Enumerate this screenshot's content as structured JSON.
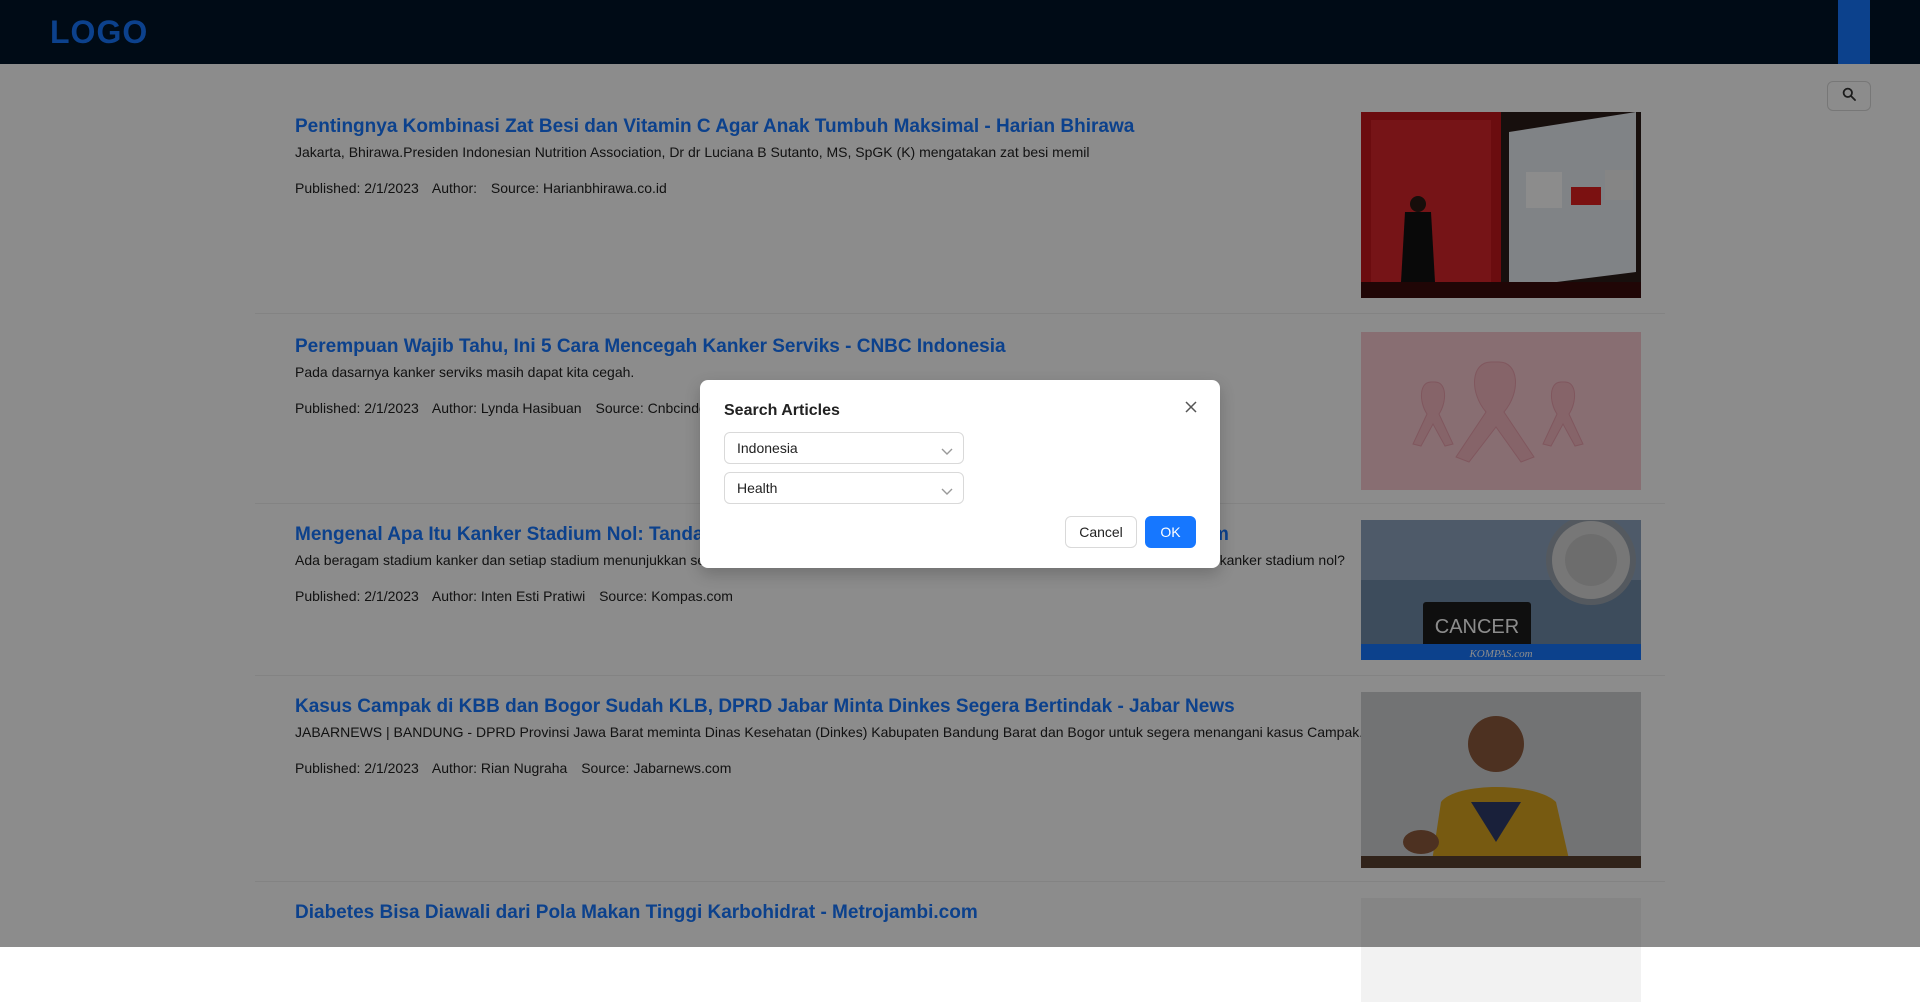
{
  "header": {
    "logo": "LOGO"
  },
  "articles": [
    {
      "title": "Pentingnya Kombinasi Zat Besi dan Vitamin C Agar Anak Tumbuh Maksimal - Harian Bhirawa",
      "description": "Jakarta, Bhirawa.Presiden Indonesian Nutrition Association, Dr dr Luciana B Sutanto, MS, SpGK (K) mengatakan zat besi memil",
      "published": "Published: 2/1/2023",
      "author": "Author:",
      "source": "Source: Harianbhirawa.co.id",
      "thumb_text": []
    },
    {
      "title": "Perempuan Wajib Tahu, Ini 5 Cara Mencegah Kanker Serviks - CNBC Indonesia",
      "description": "Pada dasarnya kanker serviks masih dapat kita cegah.",
      "published": "Published: 2/1/2023",
      "author": "Author: Lynda Hasibuan",
      "source": "Source: Cnbcindonesia.com",
      "thumb_text": []
    },
    {
      "title": "Mengenal Apa Itu Kanker Stadium Nol: Tanda-tanda, Penyebab, dan Cara Mengobatinya - KOMPAS.com",
      "description": "Ada beragam stadium kanker dan setiap stadium menunjukkan seberapa jauh kanker telah menyebar. Lalu, apa sebenarnya yang dimaksud dengan kanker stadium nol?",
      "published": "Published: 2/1/2023",
      "author": "Author: Inten Esti Pratiwi",
      "source": "Source: Kompas.com",
      "thumb_text": [
        "CANCER",
        "KOMPAS.com"
      ]
    },
    {
      "title": "Kasus Campak di KBB dan Bogor Sudah KLB, DPRD Jabar Minta Dinkes Segera Bertindak - Jabar News",
      "description": "JABARNEWS | BANDUNG - DPRD Provinsi Jawa Barat meminta Dinas Kesehatan (Dinkes) Kabupaten Bandung Barat dan Bogor untuk segera menangani kasus Campak.",
      "published": "Published: 2/1/2023",
      "author": "Author: Rian Nugraha",
      "source": "Source: Jabarnews.com",
      "thumb_text": []
    },
    {
      "title": "Diabetes Bisa Diawali dari Pola Makan Tinggi Karbohidrat - Metrojambi.com",
      "description": "",
      "published": "",
      "author": "",
      "source": "",
      "thumb_text": []
    }
  ],
  "modal": {
    "title": "Search Articles",
    "country_select": "Indonesia",
    "category_select": "Health",
    "cancel_label": "Cancel",
    "ok_label": "OK"
  },
  "colors": {
    "header_bg": "#001529",
    "accent": "#1677ff",
    "overlay": "rgba(0,0,0,0.45)"
  },
  "icons": {
    "search": "search-icon",
    "close": "close-icon",
    "chevron": "chevron-down-icon"
  }
}
